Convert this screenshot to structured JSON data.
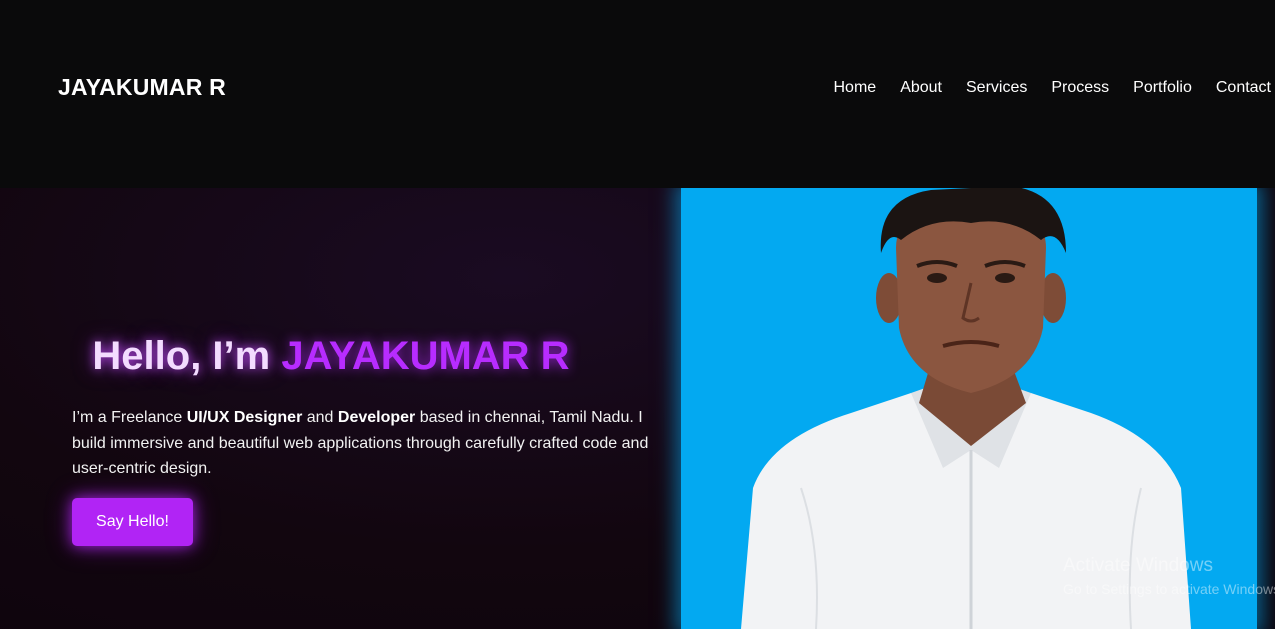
{
  "header": {
    "brand": "JAYAKUMAR R",
    "nav": [
      {
        "label": "Home"
      },
      {
        "label": "About"
      },
      {
        "label": "Services"
      },
      {
        "label": "Process"
      },
      {
        "label": "Portfolio"
      },
      {
        "label": "Contact"
      }
    ]
  },
  "hero": {
    "greeting": "Hello, I’m ",
    "name": "JAYAKUMAR R",
    "desc_1": "I’m a Freelance ",
    "desc_role_1": "UI/UX Designer",
    "desc_2": " and ",
    "desc_role_2": "Developer",
    "desc_3": " based in chennai, Tamil Nadu. I build immersive and beautiful web applications through carefully crafted code and user-centric design.",
    "cta_label": "Say Hello!",
    "photo_alt": "Portrait photo"
  },
  "watermark": {
    "title": "Activate Windows",
    "subtitle": "Go to Settings to activate Windows."
  },
  "colors": {
    "accent_purple": "#b124f5",
    "photo_background": "#03a9f1",
    "page_background": "#0a0a0b"
  }
}
